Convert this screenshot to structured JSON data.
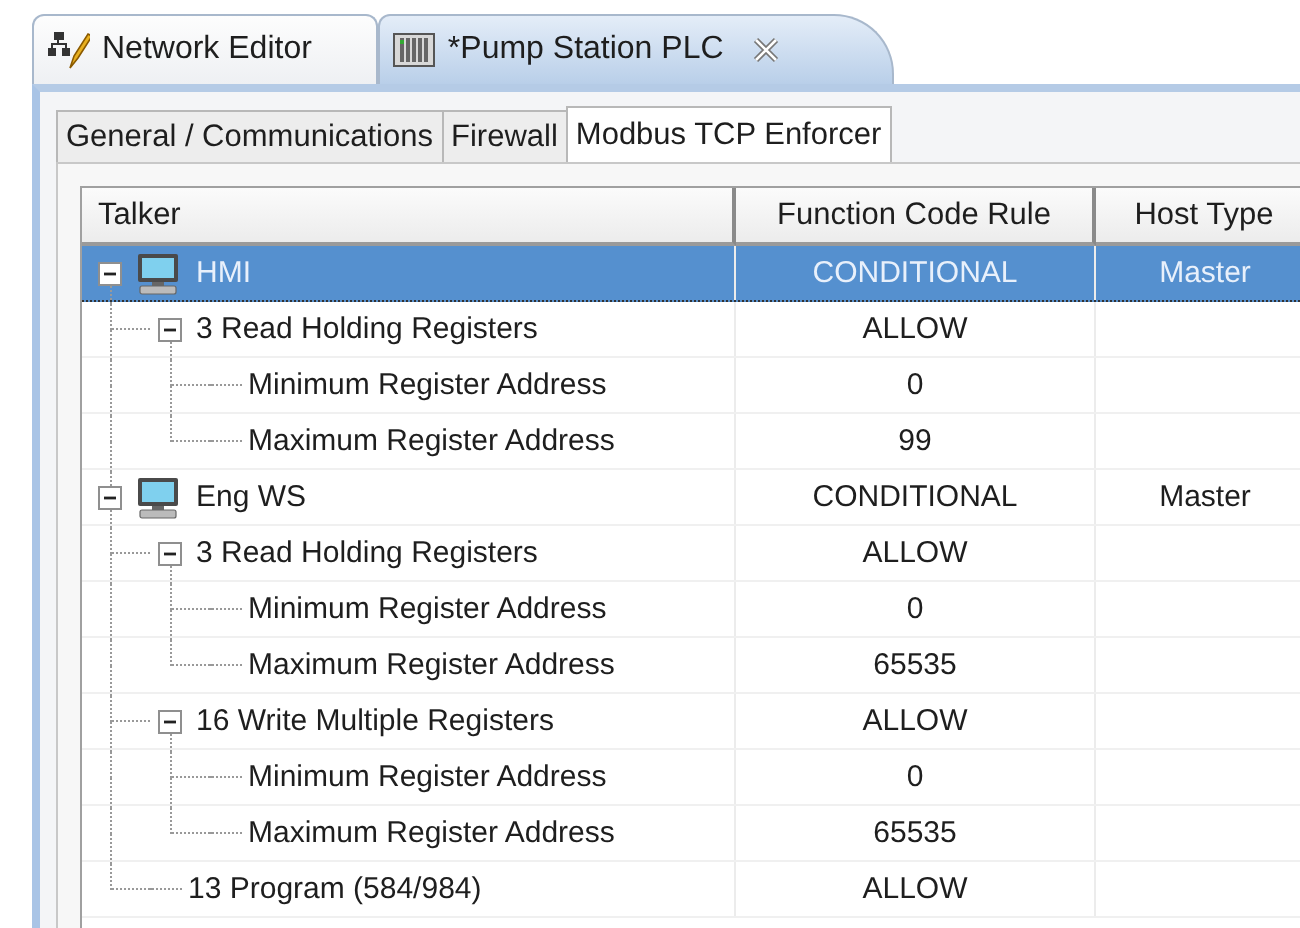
{
  "editor_tabs": [
    {
      "label": "Network Editor",
      "kind": "network",
      "selected": false,
      "closable": false
    },
    {
      "label": "*Pump Station PLC",
      "kind": "plc",
      "selected": true,
      "closable": true
    }
  ],
  "inner_tabs": [
    {
      "label": "General / Communications",
      "selected": false
    },
    {
      "label": "Firewall",
      "selected": false
    },
    {
      "label": "Modbus TCP Enforcer",
      "selected": true
    }
  ],
  "table": {
    "columns": [
      "Talker",
      "Function Code Rule",
      "Host Type"
    ],
    "rows": [
      {
        "talker": "HMI",
        "rule": "CONDITIONAL",
        "host_type": "Master",
        "selected": true,
        "expanded": true,
        "children": [
          {
            "talker": "3 Read Holding Registers",
            "rule": "ALLOW",
            "selected": false,
            "expanded": true,
            "children": [
              {
                "talker": "Minimum Register Address",
                "rule": "0",
                "selected": false
              },
              {
                "talker": "Maximum Register Address",
                "rule": "99",
                "selected": false
              }
            ]
          }
        ]
      },
      {
        "talker": "Eng WS",
        "rule": "CONDITIONAL",
        "host_type": "Master",
        "selected": false,
        "expanded": true,
        "children": [
          {
            "talker": "3 Read Holding Registers",
            "rule": "ALLOW",
            "selected": false,
            "expanded": true,
            "children": [
              {
                "talker": "Minimum Register Address",
                "rule": "0",
                "selected": false
              },
              {
                "talker": "Maximum Register Address",
                "rule": "65535",
                "selected": false
              }
            ]
          },
          {
            "talker": "16 Write Multiple Registers",
            "rule": "ALLOW",
            "selected": false,
            "expanded": true,
            "children": [
              {
                "talker": "Minimum Register Address",
                "rule": "0",
                "selected": false
              },
              {
                "talker": "Maximum Register Address",
                "rule": "65535",
                "selected": false
              }
            ]
          },
          {
            "talker": "13 Program (584/984)",
            "rule": "ALLOW",
            "selected": false
          }
        ]
      }
    ]
  }
}
